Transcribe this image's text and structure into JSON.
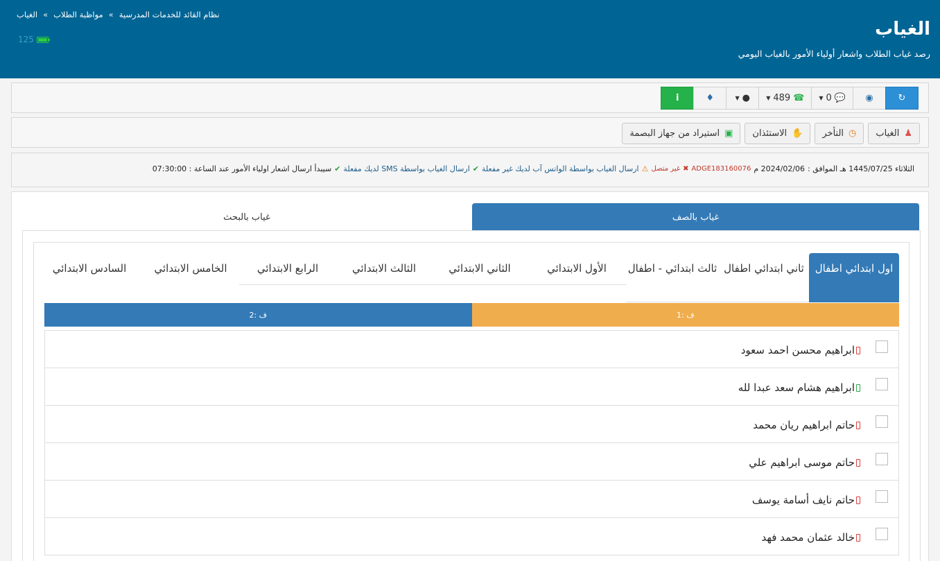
{
  "breadcrumb": {
    "home": "نظام القائد للخدمات المدرسية",
    "section": "مواظبة الطلاب",
    "current": "الغياب",
    "separator": "»"
  },
  "header": {
    "title": "الغياب",
    "subtitle": "رصد غياب الطلاب واشعار أولياء الأمور بالغياب اليومي",
    "battery_value": "125"
  },
  "toolbar": {
    "whatsapp_count": "489",
    "sms_count": "0"
  },
  "actions": {
    "absence": "الغياب",
    "late": "التأخر",
    "permission": "الاستئذان",
    "import": "استيراد من جهاز البصمة"
  },
  "info": {
    "date_hijri": "الثلاثاء 1445/07/25 هـ الموافق :",
    "date_greg": "2024/02/06 م",
    "device_id": "ADGE183160076",
    "device_status": "غير متصل",
    "whatsapp_status": "ارسال الغياب بواسطة الواتس آب لديك غير مفعلة",
    "sms_status": "ارسال الغياب بواسطة SMS لديك مفعلة",
    "start_time": "سيبدأ ارسال اشعار اولياء الأمور عند الساعة : 07:30:00"
  },
  "main_tabs": {
    "by_class": "غياب بالصف",
    "by_search": "غياب بالبحث"
  },
  "grades": [
    "اول ابتدائي اطفال",
    "ثاني ابتدائي اطفال",
    "ثالث ابتدائي - اطفال",
    "الأول الابتدائي",
    "الثاني الابتدائي",
    "الثالث الابتدائي",
    "الرابع الابتدائي",
    "الخامس الابتدائي",
    "السادس الابتدائي"
  ],
  "classes": [
    "ف :1",
    "ف :2"
  ],
  "students": [
    {
      "name": "ابراهيم محسن احمد سعود",
      "phone_ok": false
    },
    {
      "name": "ابراهيم هشام سعد عبدا لله",
      "phone_ok": true
    },
    {
      "name": "حاتم ابراهيم ريان محمد",
      "phone_ok": false
    },
    {
      "name": "حاتم موسى ابراهيم علي",
      "phone_ok": false
    },
    {
      "name": "حاتم نايف أسامة يوسف",
      "phone_ok": false
    },
    {
      "name": "خالد عثمان محمد فهد",
      "phone_ok": false
    }
  ]
}
